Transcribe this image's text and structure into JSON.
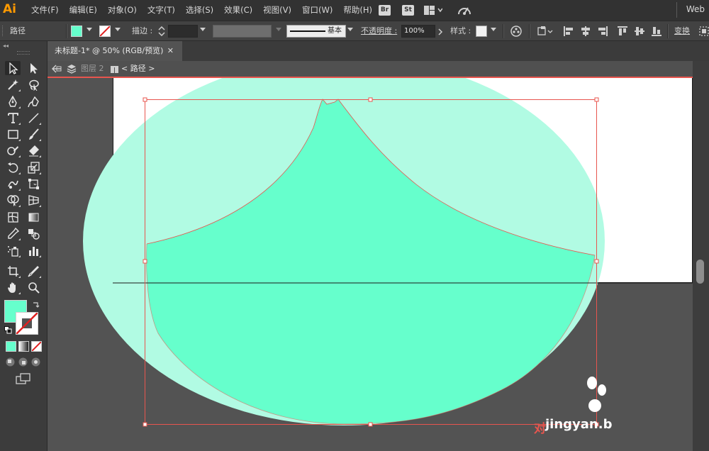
{
  "app": {
    "logo": "Ai",
    "workspace": "Web"
  },
  "menu": [
    "文件(F)",
    "编辑(E)",
    "对象(O)",
    "文字(T)",
    "选择(S)",
    "效果(C)",
    "视图(V)",
    "窗口(W)",
    "帮助(H)"
  ],
  "menu_icons": {
    "bridge": "Br",
    "stock": "St"
  },
  "control_bar": {
    "object_type": "路径",
    "fill_color": "#66ffcc",
    "stroke_label": "描边 :",
    "stroke_value": "",
    "brush_label": "基本",
    "opacity_label": "不透明度 :",
    "opacity_value": "100%",
    "style_label": "样式 :",
    "transform_label": "变换"
  },
  "document_tab": {
    "title": "未标题-1* @ 50% (RGB/预览)",
    "close": "✕"
  },
  "breadcrumb": {
    "layer": "图层 2",
    "path": "< 路径 >"
  },
  "colors": {
    "shape_fill": "#66ffcc",
    "shape_fill_light": "#b1fbe3",
    "selection_red": "#e8554e",
    "panel_dark": "#323232",
    "panel_mid": "#424242",
    "canvas_gray": "#535353"
  },
  "tools": [
    "selection-tool-icon",
    "direct-selection-tool-icon",
    "magic-wand-icon",
    "lasso-icon",
    "pen-tool-icon",
    "curvature-icon",
    "type-tool-icon",
    "line-segment-icon",
    "rectangle-tool-icon",
    "paintbrush-icon",
    "shaper-icon",
    "eraser-icon",
    "rotate-icon",
    "scale-icon",
    "warp-icon",
    "free-transform-icon",
    "shape-builder-icon",
    "perspective-grid-icon",
    "mesh-icon",
    "gradient-icon",
    "eyedropper-icon",
    "blend-icon",
    "symbol-sprayer-icon",
    "column-graph-icon",
    "artboard-icon",
    "slice-icon",
    "hand-icon",
    "zoom-icon"
  ],
  "watermark": {
    "text": "jingyan.b",
    "prefix": "对"
  }
}
